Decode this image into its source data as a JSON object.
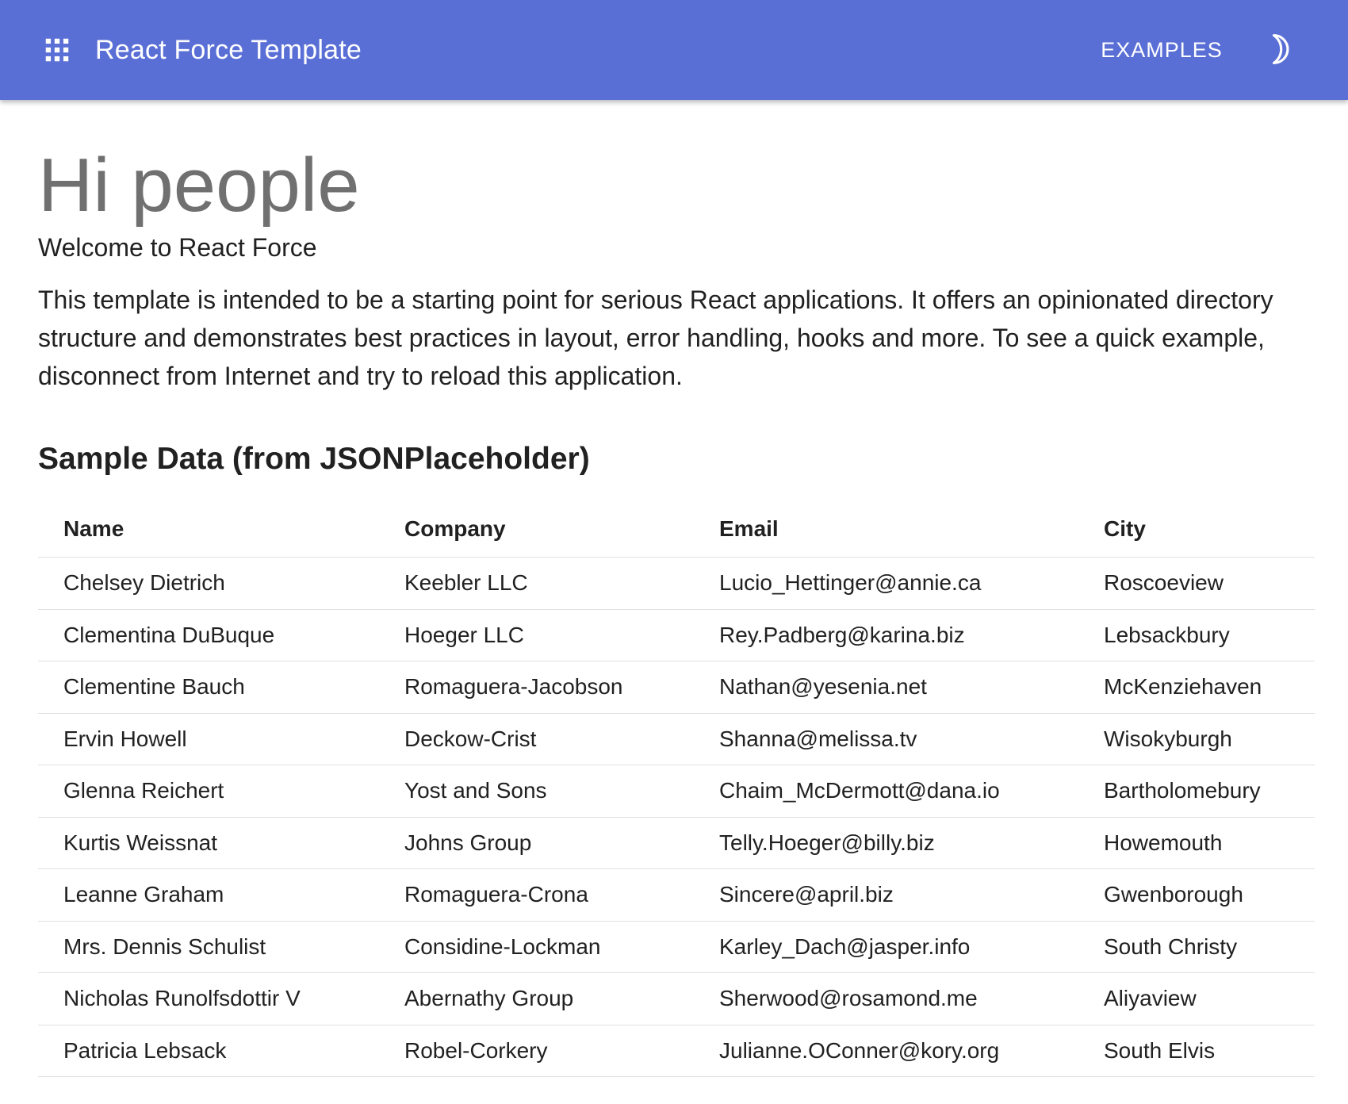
{
  "appbar": {
    "title": "React Force Template",
    "examples_label": "EXAMPLES",
    "background": "#5a6fd6",
    "apps_icon": "apps-grid-icon",
    "theme_icon": "moon-icon"
  },
  "hero": {
    "title": "Hi people",
    "subtitle": "Welcome to React Force"
  },
  "intro": "This template is intended to be a starting point for serious React applications. It offers an opinionated directory structure and demonstrates best practices in layout, error handling, hooks and more. To see a quick example, disconnect from Internet and try to reload this application.",
  "sample_data": {
    "title": "Sample Data (from JSONPlaceholder)",
    "columns": [
      "Name",
      "Company",
      "Email",
      "City"
    ],
    "rows": [
      [
        "Chelsey Dietrich",
        "Keebler LLC",
        "Lucio_Hettinger@annie.ca",
        "Roscoeview"
      ],
      [
        "Clementina DuBuque",
        "Hoeger LLC",
        "Rey.Padberg@karina.biz",
        "Lebsackbury"
      ],
      [
        "Clementine Bauch",
        "Romaguera-Jacobson",
        "Nathan@yesenia.net",
        "McKenziehaven"
      ],
      [
        "Ervin Howell",
        "Deckow-Crist",
        "Shanna@melissa.tv",
        "Wisokyburgh"
      ],
      [
        "Glenna Reichert",
        "Yost and Sons",
        "Chaim_McDermott@dana.io",
        "Bartholomebury"
      ],
      [
        "Kurtis Weissnat",
        "Johns Group",
        "Telly.Hoeger@billy.biz",
        "Howemouth"
      ],
      [
        "Leanne Graham",
        "Romaguera-Crona",
        "Sincere@april.biz",
        "Gwenborough"
      ],
      [
        "Mrs. Dennis Schulist",
        "Considine-Lockman",
        "Karley_Dach@jasper.info",
        "South Christy"
      ],
      [
        "Nicholas Runolfsdottir V",
        "Abernathy Group",
        "Sherwood@rosamond.me",
        "Aliyaview"
      ],
      [
        "Patricia Lebsack",
        "Robel-Corkery",
        "Julianne.OConner@kory.org",
        "South Elvis"
      ]
    ]
  }
}
